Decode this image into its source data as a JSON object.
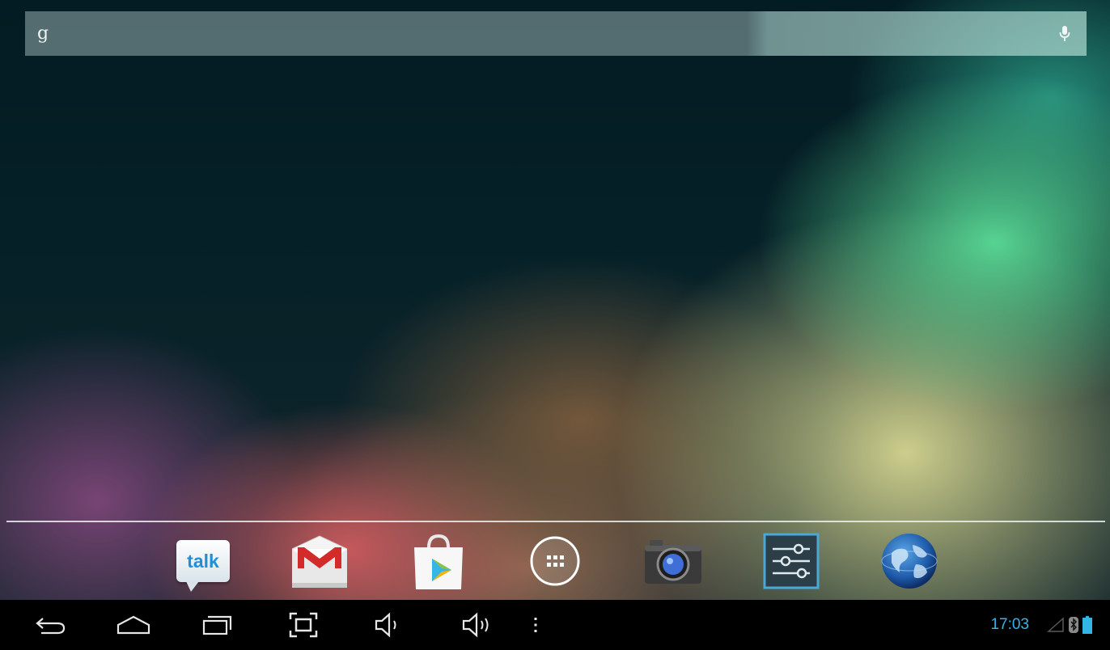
{
  "search": {
    "logo_text": "g",
    "logo_icon": "google-g-icon",
    "mic_icon": "mic-icon"
  },
  "dock": {
    "apps": [
      {
        "name": "talk",
        "label": "talk",
        "icon": "talk-icon"
      },
      {
        "name": "gmail",
        "icon": "gmail-icon"
      },
      {
        "name": "play-store",
        "icon": "play-store-icon"
      },
      {
        "name": "all-apps",
        "icon": "app-drawer-icon"
      },
      {
        "name": "camera",
        "icon": "camera-icon"
      },
      {
        "name": "settings",
        "icon": "settings-icon"
      },
      {
        "name": "browser",
        "icon": "globe-icon"
      }
    ]
  },
  "navbar": {
    "buttons": [
      "back",
      "home",
      "recent-apps",
      "screenshot",
      "volume-down",
      "volume-up",
      "menu"
    ]
  },
  "status": {
    "time": "17:03",
    "icons": [
      "signal-icon",
      "bluetooth-icon",
      "battery-icon"
    ],
    "accent_color": "#33b5e5"
  }
}
